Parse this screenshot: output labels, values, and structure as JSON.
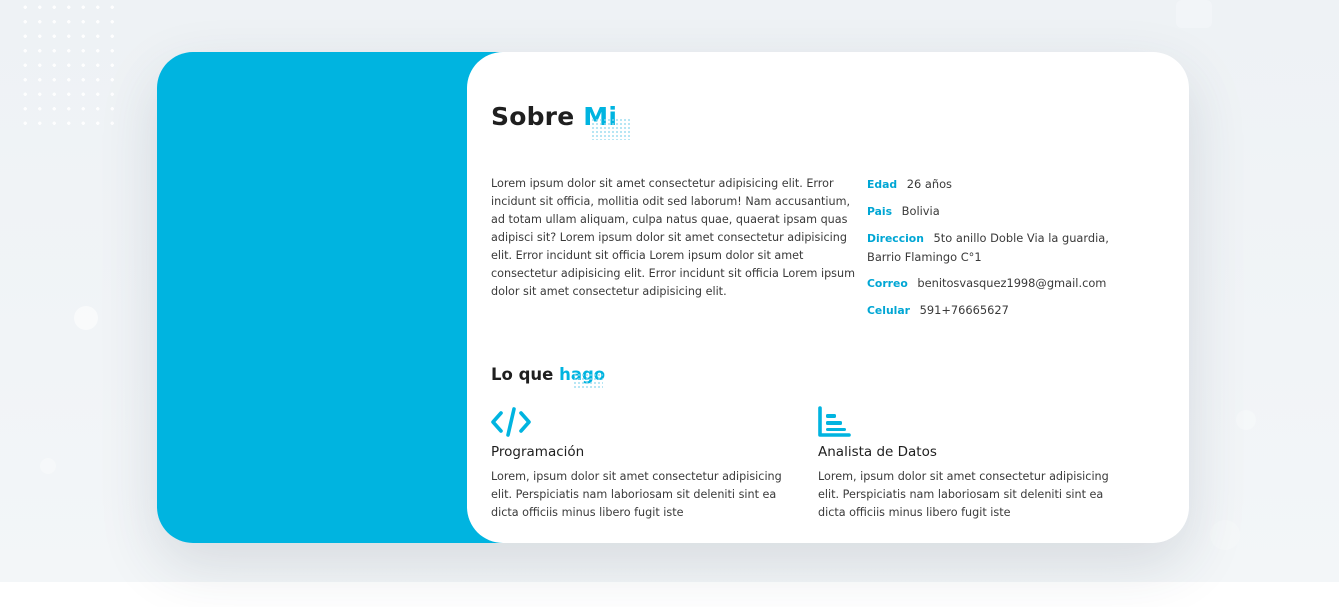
{
  "about": {
    "title": "Sobre",
    "title_accent": "Mi",
    "paragraph": "Lorem ipsum dolor sit amet consectetur adipisicing elit. Error incidunt sit officia, mollitia odit sed laborum! Nam accusantium, ad totam ullam aliquam, culpa natus quae, quaerat ipsam quas adipisci sit? Lorem ipsum dolor sit amet consectetur adipisicing elit. Error incidunt sit officia Lorem ipsum dolor sit amet consectetur adipisicing elit. Error incidunt sit officia Lorem ipsum dolor sit amet consectetur adipisicing elit."
  },
  "info": [
    {
      "label": "Edad",
      "value": "26 años"
    },
    {
      "label": "Pais",
      "value": "Bolivia"
    },
    {
      "label": "Direccion",
      "value": "5to anillo Doble Via la guardia, Barrio Flamingo C°1"
    },
    {
      "label": "Correo",
      "value": "benitosvasquez1998@gmail.com"
    },
    {
      "label": "Celular",
      "value": "591+76665627"
    }
  ],
  "services": {
    "title": "Lo que",
    "title_accent": "hago",
    "items": [
      {
        "icon": "code-icon",
        "title": "Programación",
        "text": "Lorem, ipsum dolor sit amet consectetur adipisicing elit. Perspiciatis nam laboriosam sit deleniti sint ea dicta officiis minus libero fugit iste"
      },
      {
        "icon": "chart-bar-icon",
        "title": "Analista de Datos",
        "text": "Lorem, ipsum dolor sit amet consectetur adipisicing elit. Perspiciatis nam laboriosam sit deleniti sint ea dicta officiis minus libero fugit iste"
      }
    ]
  },
  "colors": {
    "accent": "#00b4e0",
    "text": "#3a3a3a",
    "heading": "#1f1f1f"
  }
}
